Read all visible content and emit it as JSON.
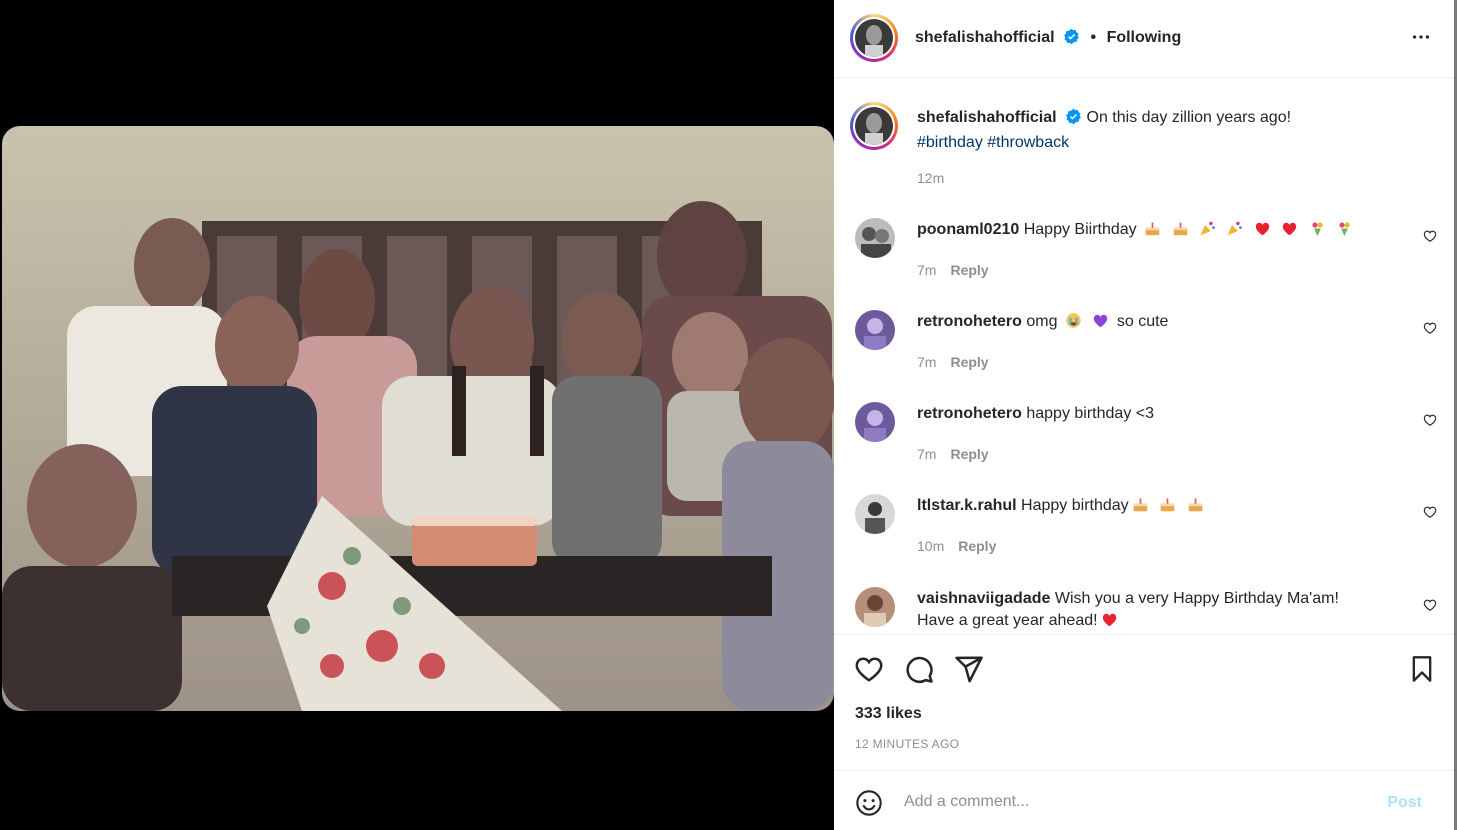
{
  "post": {
    "username": "shefalishahofficial",
    "follow_status": "Following",
    "caption": "On this day zillion years ago!",
    "hashtags": [
      "#birthday",
      "#throwback"
    ],
    "caption_time": "12m"
  },
  "comments": [
    {
      "username": "poonaml0210",
      "text": "Happy Biirthday",
      "emojis": [
        "cake",
        "cake",
        "party",
        "party",
        "heart",
        "heart",
        "bouquet",
        "bouquet"
      ],
      "time": "7m",
      "reply": "Reply"
    },
    {
      "username": "retronohetero",
      "text": "omg",
      "emojis": [
        "crying",
        "purple-heart"
      ],
      "text_after": "so cute",
      "time": "7m",
      "reply": "Reply"
    },
    {
      "username": "retronohetero",
      "text": "happy birthday <3",
      "time": "7m",
      "reply": "Reply"
    },
    {
      "username": "ltlstar.k.rahul",
      "text": "Happy birthday",
      "emojis": [
        "cake",
        "cake",
        "cake"
      ],
      "time": "10m",
      "reply": "Reply"
    },
    {
      "username": "vaishnaviigadade",
      "text": "Wish you a very Happy Birthday Ma'am!",
      "text_line2": "Have a great year ahead!",
      "emojis": [
        "heart"
      ]
    }
  ],
  "stats": {
    "likes": "333 likes",
    "posted": "12 MINUTES AGO"
  },
  "composer": {
    "placeholder": "Add a comment...",
    "post_label": "Post"
  },
  "colors": {
    "link": "#00376b",
    "verified": "#0095f6",
    "post_disabled": "#b2dffc",
    "muted": "#8e8e8e"
  }
}
